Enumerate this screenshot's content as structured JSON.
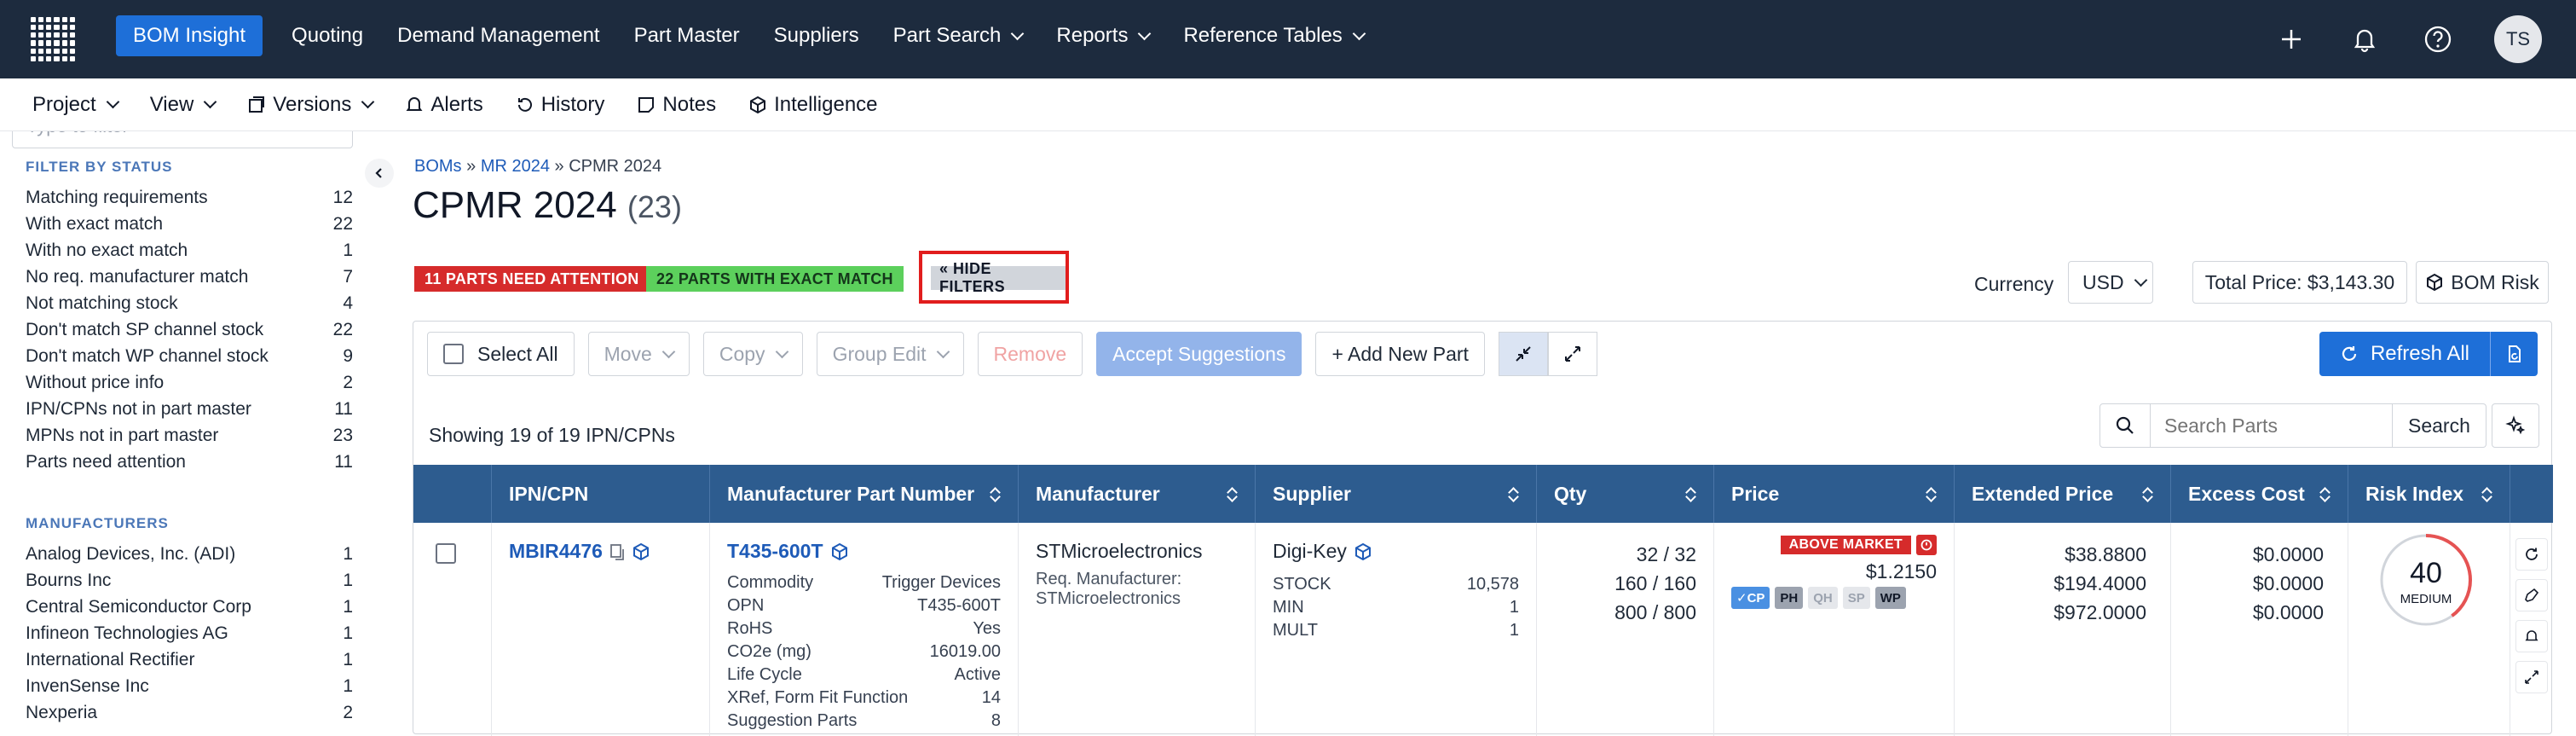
{
  "nav": {
    "items": [
      "BOM Insight",
      "Quoting",
      "Demand Management",
      "Part Master",
      "Suppliers",
      "Part Search",
      "Reports",
      "Reference Tables"
    ],
    "avatar": "TS"
  },
  "subnav": {
    "project": "Project",
    "view": "View",
    "versions": "Versions",
    "alerts": "Alerts",
    "history": "History",
    "notes": "Notes",
    "intelligence": "Intelligence"
  },
  "sidebar": {
    "filter_placeholder": "Type to filter",
    "status_heading": "FILTER BY STATUS",
    "status": [
      {
        "label": "Matching requirements",
        "count": "12"
      },
      {
        "label": "With exact match",
        "count": "22"
      },
      {
        "label": "With no exact match",
        "count": "1"
      },
      {
        "label": "No req. manufacturer match",
        "count": "7"
      },
      {
        "label": "Not matching stock",
        "count": "4"
      },
      {
        "label": "Don't match SP channel stock",
        "count": "22"
      },
      {
        "label": "Don't match WP channel stock",
        "count": "9"
      },
      {
        "label": "Without price info",
        "count": "2"
      },
      {
        "label": "IPN/CPNs not in part master",
        "count": "11"
      },
      {
        "label": "MPNs not in part master",
        "count": "23"
      },
      {
        "label": "Parts need attention",
        "count": "11"
      }
    ],
    "mfr_heading": "MANUFACTURERS",
    "manufacturers": [
      {
        "label": "Analog Devices, Inc. (ADI)",
        "count": "1"
      },
      {
        "label": "Bourns Inc",
        "count": "1"
      },
      {
        "label": "Central Semiconductor Corp",
        "count": "1"
      },
      {
        "label": "Infineon Technologies AG",
        "count": "1"
      },
      {
        "label": "International Rectifier",
        "count": "1"
      },
      {
        "label": "InvenSense Inc",
        "count": "1"
      },
      {
        "label": "Nexperia",
        "count": "2"
      }
    ]
  },
  "breadcrumb": {
    "boms": "BOMs",
    "mr": "MR 2024",
    "current": "CPMR 2024",
    "sep": "»"
  },
  "title": {
    "name": "CPMR 2024",
    "count": "(23)"
  },
  "badges": {
    "attention": "11 PARTS NEED ATTENTION",
    "exact": "22 PARTS WITH EXACT MATCH",
    "hide_filters": "« HIDE FILTERS"
  },
  "currency": {
    "label": "Currency",
    "value": "USD"
  },
  "total_price": "Total Price: $3,143.30",
  "bom_risk": "BOM Risk",
  "toolbar": {
    "select_all": "Select All",
    "move": "Move",
    "copy": "Copy",
    "group_edit": "Group Edit",
    "remove": "Remove",
    "accept": "Accept Suggestions",
    "add_part": "+ Add New Part",
    "refresh": "Refresh All"
  },
  "showing": "Showing 19 of 19 IPN/CPNs",
  "search": {
    "placeholder": "Search Parts",
    "button": "Search"
  },
  "columns": [
    "IPN/CPN",
    "Manufacturer Part Number",
    "Manufacturer",
    "Supplier",
    "Qty",
    "Price",
    "Extended Price",
    "Excess Cost",
    "Risk Index"
  ],
  "row": {
    "ipn": "MBIR4476",
    "mpn": "T435-600T",
    "attrs": [
      {
        "k": "Commodity",
        "v": "Trigger Devices"
      },
      {
        "k": "OPN",
        "v": "T435-600T"
      },
      {
        "k": "RoHS",
        "v": "Yes"
      },
      {
        "k": "CO2e (mg)",
        "v": "16019.00"
      },
      {
        "k": "Life Cycle",
        "v": "Active"
      },
      {
        "k": "XRef, Form Fit Function",
        "v": "14"
      },
      {
        "k": "Suggestion Parts",
        "v": "8"
      }
    ],
    "manufacturer": "STMicroelectronics",
    "req_label": "Req. Manufacturer:",
    "req_value": "STMicroelectronics",
    "supplier": "Digi-Key",
    "supplier_attrs": [
      {
        "k": "STOCK",
        "v": "10,578"
      },
      {
        "k": "MIN",
        "v": "1"
      },
      {
        "k": "MULT",
        "v": "1"
      }
    ],
    "qty": [
      "32 / 32",
      "160 / 160",
      "800 / 800"
    ],
    "above_market": "ABOVE MARKET",
    "price": "$1.2150",
    "pills": [
      "✓CP",
      "PH",
      "QH",
      "SP",
      "WP"
    ],
    "extended": [
      "$38.8800",
      "$194.4000",
      "$972.0000"
    ],
    "excess": [
      "$0.0000",
      "$0.0000",
      "$0.0000"
    ],
    "risk_value": "40",
    "risk_label": "MEDIUM",
    "risk_fraction": 0.4
  },
  "colors": {
    "nav_bg": "#1d2b3e",
    "primary": "#1e6fd8",
    "header_bg": "#2d5c8f",
    "danger": "#d62b2b",
    "success": "#5cd05c"
  }
}
